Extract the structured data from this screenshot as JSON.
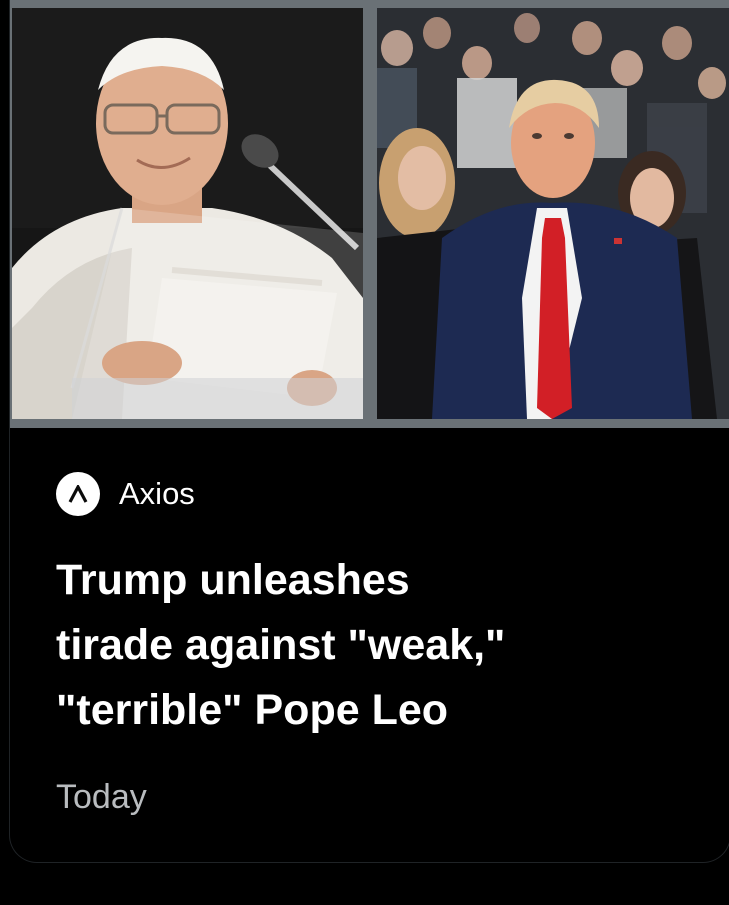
{
  "article": {
    "source_name": "Axios",
    "source_logo_icon": "axios-logo-icon",
    "headline_lines": [
      "Trump unleashes",
      "tirade against \"weak,\"",
      "\"terrible\" Pope Leo"
    ],
    "timestamp": "Today"
  },
  "images": {
    "left": "pope-at-podium-photo",
    "right": "man-in-suit-crowd-photo"
  },
  "colors": {
    "background": "#000000",
    "headline": "#ffffff",
    "timestamp": "#b9bcbf",
    "image_gap": "#6a7176"
  }
}
